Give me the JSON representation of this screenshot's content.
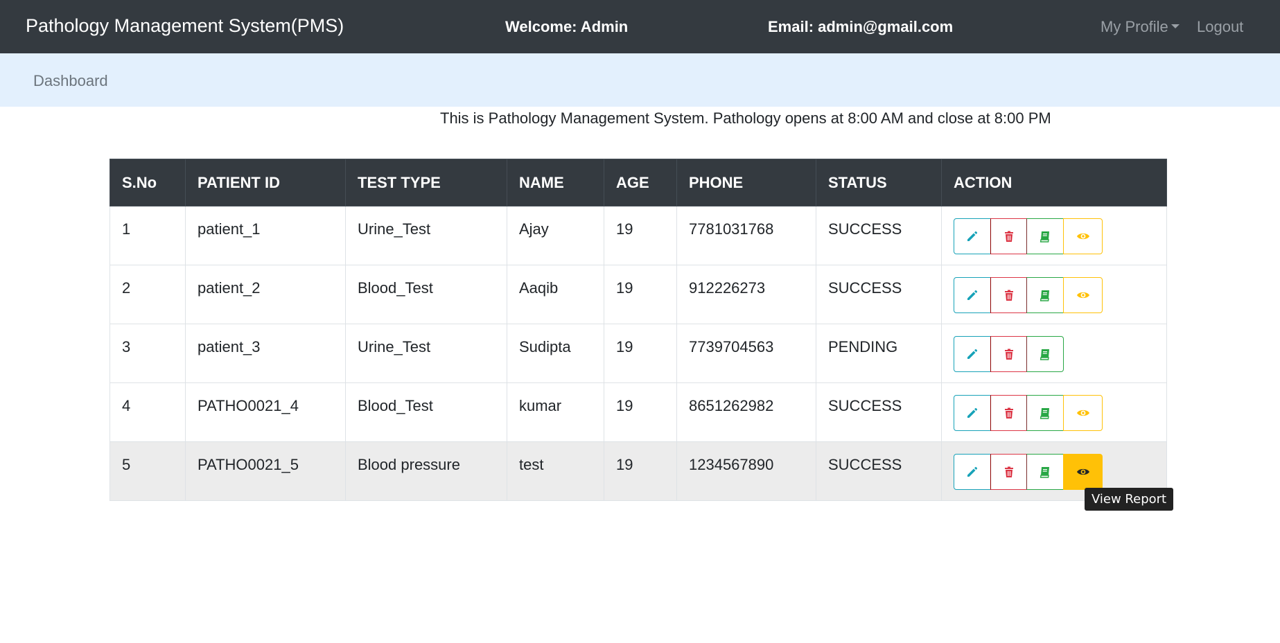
{
  "navbar": {
    "brand": "Pathology Management System(PMS)",
    "welcome": "Welcome: Admin",
    "email": "Email: admin@gmail.com",
    "profile": "My Profile",
    "logout": "Logout"
  },
  "subnav": {
    "dashboard": "Dashboard"
  },
  "intro_text": "This is Pathology Management System. Pathology opens at 8:00 AM and close at 8:00 PM",
  "table": {
    "headers": [
      "S.No",
      "PATIENT ID",
      "TEST TYPE",
      "NAME",
      "AGE",
      "PHONE",
      "STATUS",
      "ACTION"
    ],
    "rows": [
      {
        "sno": "1",
        "patient_id": "patient_1",
        "test_type": "Urine_Test",
        "name": "Ajay",
        "age": "19",
        "phone": "7781031768",
        "status": "SUCCESS"
      },
      {
        "sno": "2",
        "patient_id": "patient_2",
        "test_type": "Blood_Test",
        "name": "Aaqib",
        "age": "19",
        "phone": "912226273",
        "status": "SUCCESS"
      },
      {
        "sno": "3",
        "patient_id": "patient_3",
        "test_type": "Urine_Test",
        "name": "Sudipta",
        "age": "19",
        "phone": "7739704563",
        "status": "PENDING"
      },
      {
        "sno": "4",
        "patient_id": "PATHO0021_4",
        "test_type": "Blood_Test",
        "name": "kumar",
        "age": "19",
        "phone": "8651262982",
        "status": "SUCCESS"
      },
      {
        "sno": "5",
        "patient_id": "PATHO0021_5",
        "test_type": "Blood pressure",
        "name": "test",
        "age": "19",
        "phone": "1234567890",
        "status": "SUCCESS"
      }
    ]
  },
  "tooltip": "View Report",
  "colors": {
    "edit": "#17a2b8",
    "delete": "#dc3545",
    "book": "#28a745",
    "view": "#ffc107",
    "navbar": "#343a40",
    "subbar": "#e3f0fd"
  },
  "icons": {
    "edit": "pencil-icon",
    "delete": "trash-icon",
    "book": "book-icon",
    "view": "eye-icon"
  }
}
